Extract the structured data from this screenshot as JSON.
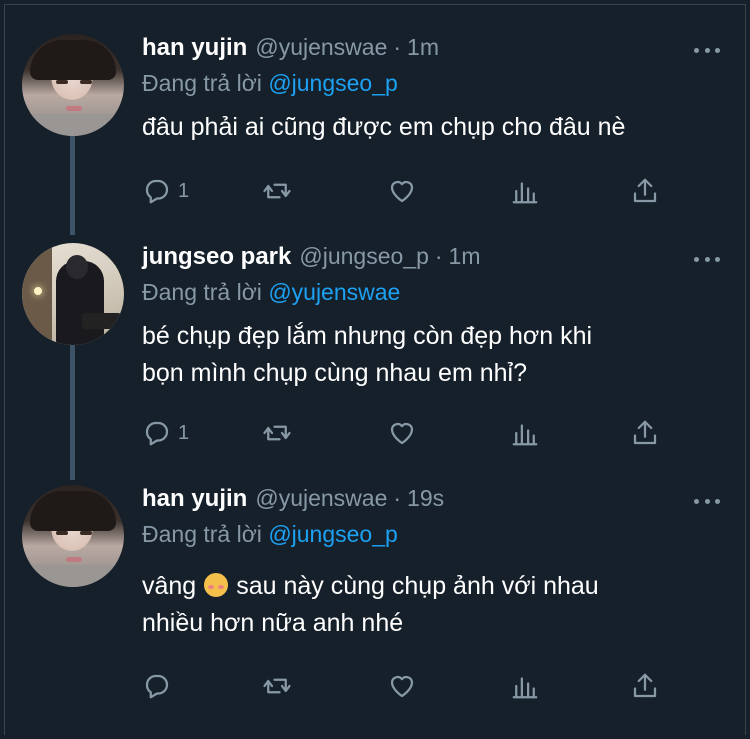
{
  "tweets": [
    {
      "name": "han yujin",
      "handle": "@yujenswae",
      "dot": "·",
      "time": "1m",
      "replying_prefix": "Đang trả lời",
      "replying_to": "@jungseo_p",
      "text_lines": [
        "đâu phải ai cũng được em chụp cho đâu nè"
      ],
      "reply_count": "1"
    },
    {
      "name": "jungseo park",
      "handle": "@jungseo_p",
      "dot": "·",
      "time": "1m",
      "replying_prefix": "Đang trả lời",
      "replying_to": "@yujenswae",
      "text_lines": [
        "bé chụp đẹp lắm nhưng còn đẹp hơn khi",
        "bọn mình chụp cùng nhau em nhỉ?"
      ],
      "reply_count": "1"
    },
    {
      "name": "han yujin",
      "handle": "@yujenswae",
      "dot": "·",
      "time": "19s",
      "replying_prefix": "Đang trả lời",
      "replying_to": "@jungseo_p",
      "text_line1_before": "vâng",
      "text_line1_after": "sau này cùng chụp ảnh với nhau",
      "text_line2": "nhiều hơn nữa anh nhé",
      "emoji": "smiling-face-with-hearts",
      "reply_count": ""
    }
  ],
  "icons": {
    "reply": "reply-icon",
    "retweet": "retweet-icon",
    "like": "heart-icon",
    "analytics": "analytics-icon",
    "share": "share-icon",
    "more": "more-icon"
  },
  "colors": {
    "background": "#15202b",
    "secondary_text": "#8899a6",
    "mention": "#1da1f2",
    "thread_line": "#3d5466"
  }
}
